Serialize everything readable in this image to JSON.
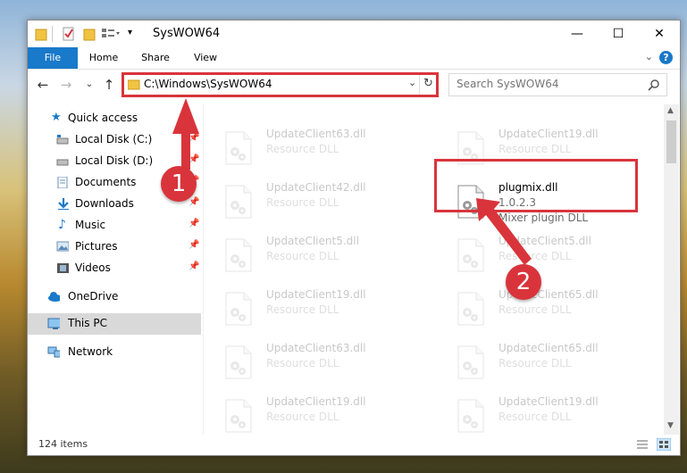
{
  "window": {
    "title": "SysWOW64",
    "controls": {
      "minimize": "—",
      "maximize": "☐",
      "close": "✕"
    }
  },
  "ribbon": {
    "tabs": [
      "File",
      "Home",
      "Share",
      "View"
    ],
    "help": "?"
  },
  "address": {
    "path": "C:\\Windows\\SysWOW64",
    "search_placeholder": "Search SysWOW64"
  },
  "navigation": {
    "quick_access": "Quick access",
    "items": [
      {
        "label": "Local Disk (C:)",
        "icon": "drive-icon",
        "pinned": true
      },
      {
        "label": "Local Disk (D:)",
        "icon": "drive-icon",
        "pinned": true
      },
      {
        "label": "Documents",
        "icon": "documents-icon",
        "pinned": true
      },
      {
        "label": "Downloads",
        "icon": "downloads-icon",
        "pinned": true
      },
      {
        "label": "Music",
        "icon": "music-icon",
        "pinned": true
      },
      {
        "label": "Pictures",
        "icon": "pictures-icon",
        "pinned": true
      },
      {
        "label": "Videos",
        "icon": "videos-icon",
        "pinned": true
      }
    ],
    "onedrive": "OneDrive",
    "this_pc": "This PC",
    "network": "Network"
  },
  "files": [
    {
      "name": "UpdateClient63.dll",
      "line2": "Resource DLL",
      "faded": true
    },
    {
      "name": "UpdateClient19.dll",
      "line2": "Resource DLL",
      "faded": true
    },
    {
      "name": "UpdateClient42.dll",
      "line2": "Resource DLL",
      "faded": true
    },
    {
      "name": "plugmix.dll",
      "line2": "1.0.2.3",
      "line3": "Mixer plugin DLL",
      "faded": false
    },
    {
      "name": "UpdateClient5.dll",
      "line2": "Resource DLL",
      "faded": true
    },
    {
      "name": "UpdateClient5.dll",
      "line2": "Resource DLL",
      "faded": true
    },
    {
      "name": "UpdateClient19.dll",
      "line2": "Resource DLL",
      "faded": true
    },
    {
      "name": "UpdateClient65.dll",
      "line2": "Resource DLL",
      "faded": true
    },
    {
      "name": "UpdateClient63.dll",
      "line2": "Resource DLL",
      "faded": true
    },
    {
      "name": "UpdateClient65.dll",
      "line2": "Resource DLL",
      "faded": true
    },
    {
      "name": "UpdateClient19.dll",
      "line2": "Resource DLL",
      "faded": true
    },
    {
      "name": "UpdateClient19.dll",
      "line2": "Resource DLL",
      "faded": true
    }
  ],
  "status": {
    "items_count": "124 items"
  },
  "annotations": {
    "step1": "1",
    "step2": "2",
    "color": "#d9343b"
  }
}
